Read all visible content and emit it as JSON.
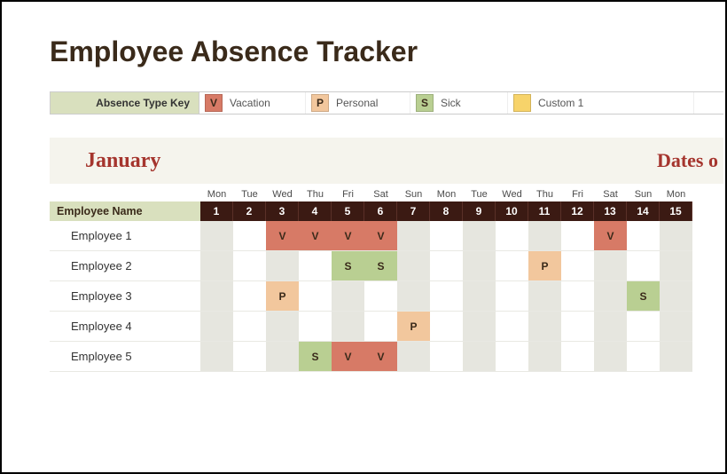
{
  "title": "Employee Absence Tracker",
  "legend": {
    "header": "Absence Type Key",
    "items": [
      {
        "code": "V",
        "label": "Vacation",
        "class": "c-v"
      },
      {
        "code": "P",
        "label": "Personal",
        "class": "c-p"
      },
      {
        "code": "S",
        "label": "Sick",
        "class": "c-s"
      },
      {
        "code": "",
        "label": "Custom 1",
        "class": "c-c"
      }
    ]
  },
  "month": {
    "name": "January",
    "dates_label": "Dates o",
    "days_of_week": [
      "Mon",
      "Tue",
      "Wed",
      "Thu",
      "Fri",
      "Sat",
      "Sun",
      "Mon",
      "Tue",
      "Wed",
      "Thu",
      "Fri",
      "Sat",
      "Sun",
      "Mon"
    ],
    "day_numbers": [
      1,
      2,
      3,
      4,
      5,
      6,
      7,
      8,
      9,
      10,
      11,
      12,
      13,
      14,
      15
    ]
  },
  "table": {
    "employee_header": "Employee Name",
    "employees": [
      {
        "name": "Employee 1",
        "cells": [
          "",
          "",
          "V",
          "V",
          "V",
          "V",
          "",
          "",
          "",
          "",
          "",
          "",
          "V",
          "",
          ""
        ]
      },
      {
        "name": "Employee 2",
        "cells": [
          "",
          "",
          "",
          "",
          "S",
          "S",
          "",
          "",
          "",
          "",
          "P",
          "",
          "",
          "",
          ""
        ]
      },
      {
        "name": "Employee 3",
        "cells": [
          "",
          "",
          "P",
          "",
          "",
          "",
          "",
          "",
          "",
          "",
          "",
          "",
          "",
          "S",
          ""
        ]
      },
      {
        "name": "Employee 4",
        "cells": [
          "",
          "",
          "",
          "",
          "",
          "",
          "P",
          "",
          "",
          "",
          "",
          "",
          "",
          "",
          ""
        ]
      },
      {
        "name": "Employee 5",
        "cells": [
          "",
          "",
          "",
          "S",
          "V",
          "V",
          "",
          "",
          "",
          "",
          "",
          "",
          "",
          "",
          ""
        ]
      }
    ]
  },
  "chart_data": {
    "type": "table",
    "title": "Employee Absence Tracker",
    "month": "January",
    "legend": {
      "V": "Vacation",
      "P": "Personal",
      "S": "Sick",
      "Custom1": "Custom 1"
    },
    "columns": [
      1,
      2,
      3,
      4,
      5,
      6,
      7,
      8,
      9,
      10,
      11,
      12,
      13,
      14,
      15
    ],
    "days_of_week": [
      "Mon",
      "Tue",
      "Wed",
      "Thu",
      "Fri",
      "Sat",
      "Sun",
      "Mon",
      "Tue",
      "Wed",
      "Thu",
      "Fri",
      "Sat",
      "Sun",
      "Mon"
    ],
    "rows": [
      {
        "employee": "Employee 1",
        "values": [
          "",
          "",
          "V",
          "V",
          "V",
          "V",
          "",
          "",
          "",
          "",
          "",
          "",
          "V",
          "",
          ""
        ]
      },
      {
        "employee": "Employee 2",
        "values": [
          "",
          "",
          "",
          "",
          "S",
          "S",
          "",
          "",
          "",
          "",
          "P",
          "",
          "",
          "",
          ""
        ]
      },
      {
        "employee": "Employee 3",
        "values": [
          "",
          "",
          "P",
          "",
          "",
          "",
          "",
          "",
          "",
          "",
          "",
          "",
          "",
          "S",
          ""
        ]
      },
      {
        "employee": "Employee 4",
        "values": [
          "",
          "",
          "",
          "",
          "",
          "",
          "P",
          "",
          "",
          "",
          "",
          "",
          "",
          "",
          ""
        ]
      },
      {
        "employee": "Employee 5",
        "values": [
          "",
          "",
          "",
          "S",
          "V",
          "V",
          "",
          "",
          "",
          "",
          "",
          "",
          "",
          "",
          ""
        ]
      }
    ]
  }
}
